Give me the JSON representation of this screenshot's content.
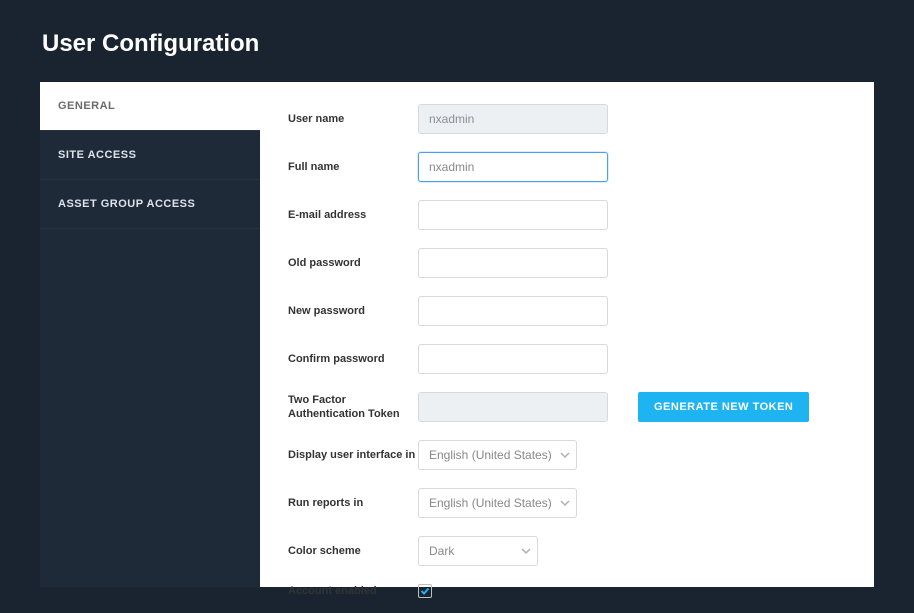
{
  "pageTitle": "User Configuration",
  "sidebar": {
    "items": [
      {
        "label": "GENERAL"
      },
      {
        "label": "SITE ACCESS"
      },
      {
        "label": "ASSET GROUP ACCESS"
      }
    ]
  },
  "form": {
    "username_label": "User name",
    "username_value": "nxadmin",
    "fullname_label": "Full name",
    "fullname_value": "nxadmin",
    "email_label": "E-mail address",
    "email_value": "",
    "oldpw_label": "Old password",
    "oldpw_value": "",
    "newpw_label": "New password",
    "newpw_value": "",
    "confirmpw_label": "Confirm password",
    "confirmpw_value": "",
    "twofa_label": "Two Factor Authentication Token",
    "twofa_value": "",
    "generate_btn": "GENERATE NEW TOKEN",
    "display_ui_label": "Display user interface in",
    "display_ui_value": "English (United States)",
    "reports_label": "Run reports in",
    "reports_value": "English (United States)",
    "colorscheme_label": "Color scheme",
    "colorscheme_value": "Dark",
    "account_enabled_label": "Account enabled",
    "account_enabled_checked": true
  },
  "colors": {
    "accent": "#1db4f1",
    "focus": "#4a9eea",
    "background": "#1a2430"
  }
}
